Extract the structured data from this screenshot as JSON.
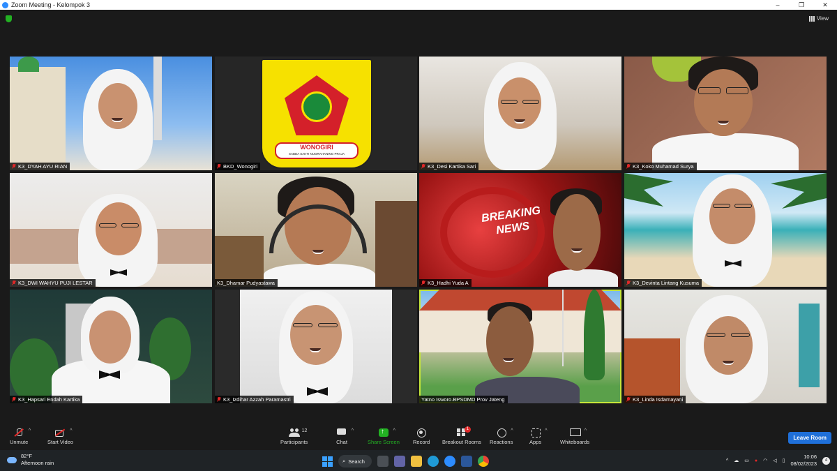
{
  "window": {
    "title": "Zoom Meeting - Kelompok 3",
    "controls": [
      "–",
      "❐",
      "✕"
    ]
  },
  "topbar": {
    "view_label": "View"
  },
  "participants": [
    {
      "name": "K3_DYAH AYU RIAN",
      "muted": true
    },
    {
      "name": "BKD_Wonogiri",
      "muted": true
    },
    {
      "name": "K3_Desi Kartika Sari",
      "muted": true
    },
    {
      "name": "K3_Koko Muhamad Surya",
      "muted": true
    },
    {
      "name": "K3_DWI WAHYU PUJI LESTAR",
      "muted": true
    },
    {
      "name": "K3_Dhamar Pudyastawa",
      "muted": false
    },
    {
      "name": "K3_Hadhi Yuda A",
      "muted": true
    },
    {
      "name": "K3_Devinta Lintang Kusuma",
      "muted": true
    },
    {
      "name": "K3_Hapsari Endah Kartika",
      "muted": true
    },
    {
      "name": "K3_Izdihar Azzah Paramastri",
      "muted": true
    },
    {
      "name": "Yatno Isworo.BPSDMD Prov Jateng",
      "muted": false,
      "active_speaker": true
    },
    {
      "name": "K3_Linda Isdamayani",
      "muted": true
    }
  ],
  "logo": {
    "top_text": "WONOGIRI",
    "motto": "SABDA SAKTI NUGRAHANING PRAJA"
  },
  "news_text": {
    "line1": "BREAKING",
    "line2": "NEWS"
  },
  "toolbar": {
    "unmute": "Unmute",
    "start_video": "Start Video",
    "participants": "Participants",
    "participants_count": "12",
    "chat": "Chat",
    "share_screen": "Share Screen",
    "record": "Record",
    "breakout": "Breakout Rooms",
    "breakout_badge": "1",
    "reactions": "Reactions",
    "apps": "Apps",
    "whiteboards": "Whiteboards",
    "leave": "Leave Room"
  },
  "taskbar": {
    "weather_temp": "82°F",
    "weather_desc": "Afternoon rain",
    "search": "Search",
    "time": "10:06",
    "date": "08/02/2023",
    "notifications": "4"
  },
  "colors": {
    "share_green": "#23b123",
    "leave_blue": "#1f6fd8",
    "active_border": "#c5e63a",
    "muted_red": "#e02828"
  }
}
